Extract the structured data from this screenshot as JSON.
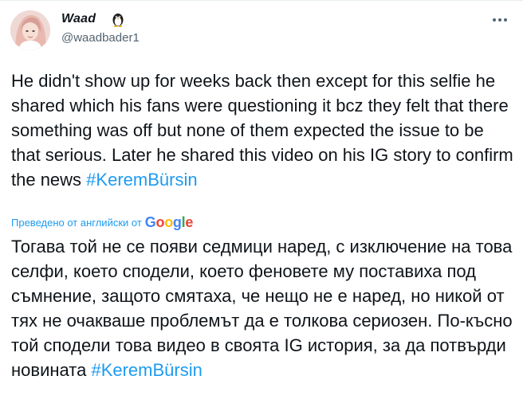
{
  "author": {
    "display_name": "Waad",
    "badge_icon": "penguin-icon",
    "handle": "@waadbader1"
  },
  "menu": {
    "icon": "more-horizontal-icon"
  },
  "tweet": {
    "text": "He didn't show up for weeks back then except for this selfie he shared which his fans were questioning it bcz they felt that there something was off but none of them expected the issue to be that serious. Later he shared this video on his IG story to confirm the news ",
    "hashtag": "#KeremBürsin"
  },
  "translation": {
    "label": "Преведено от английски от",
    "provider": [
      "G",
      "o",
      "o",
      "g",
      "l",
      "e"
    ],
    "provider_colors": [
      "#4285F4",
      "#EA4335",
      "#FBBC05",
      "#4285F4",
      "#34A853",
      "#EA4335"
    ],
    "text": "Тогава той не се появи седмици наред, с изключение на това селфи, което сподели, което феновете му поставиха под съмнение, защото смятаха, че нещо не е наред, но никой от тях не очакваше проблемът да е толкова сериозен. По-късно той сподели това видео в своята IG история, за да потвърди новината ",
    "hashtag": "#KeremBürsin"
  },
  "colors": {
    "link": "#1d9bf0",
    "text": "#0f1419",
    "secondary": "#536471"
  }
}
